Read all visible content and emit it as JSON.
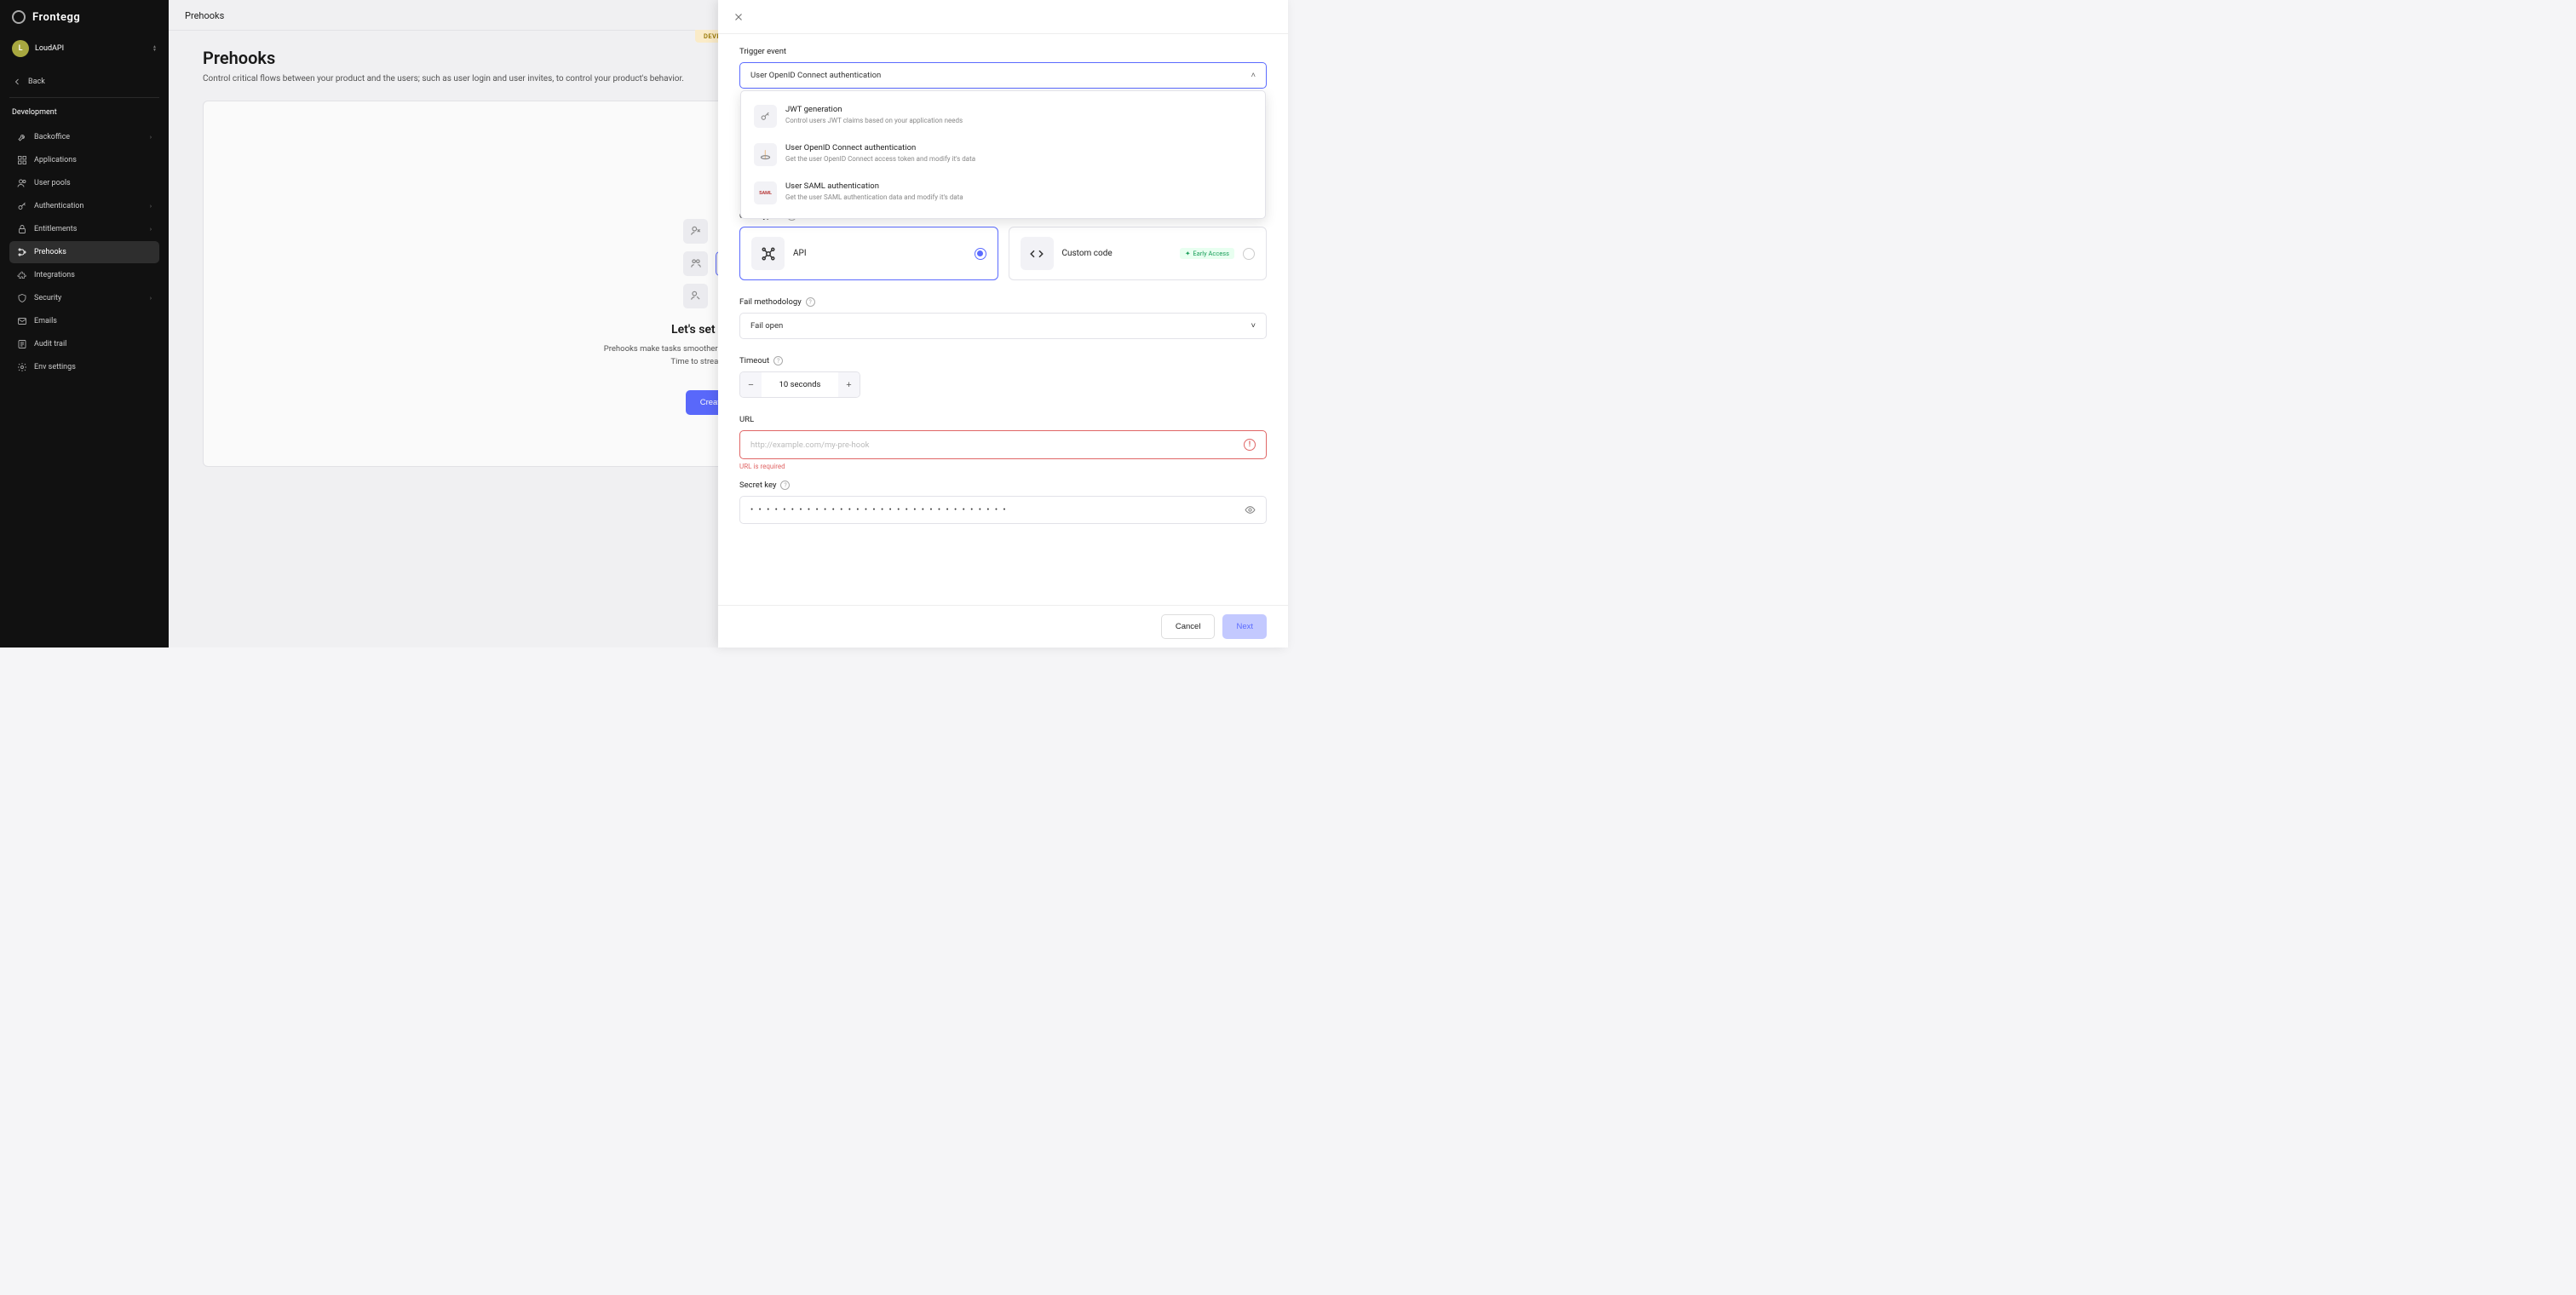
{
  "brand": {
    "name": "Frontegg"
  },
  "workspace": {
    "avatar_initial": "L",
    "name": "LoudAPI"
  },
  "back_label": "Back",
  "env_label": "Development",
  "env_pill": "DEVELOPMENT",
  "nav": [
    {
      "key": "backoffice",
      "label": "Backoffice",
      "chevron": true
    },
    {
      "key": "applications",
      "label": "Applications"
    },
    {
      "key": "user-pools",
      "label": "User pools"
    },
    {
      "key": "authentication",
      "label": "Authentication",
      "chevron": true
    },
    {
      "key": "entitlements",
      "label": "Entitlements",
      "chevron": true
    },
    {
      "key": "prehooks",
      "label": "Prehooks",
      "active": true
    },
    {
      "key": "integrations",
      "label": "Integrations"
    },
    {
      "key": "security",
      "label": "Security",
      "chevron": true
    },
    {
      "key": "emails",
      "label": "Emails"
    },
    {
      "key": "audit-trail",
      "label": "Audit trail"
    },
    {
      "key": "env-settings",
      "label": "Env settings"
    }
  ],
  "breadcrumb": "Prehooks",
  "page": {
    "title": "Prehooks",
    "description": "Control critical flows between your product and the users; such as user login and user invites, to control your product's behavior.",
    "empty_heading": "Let's set up Prehooks",
    "empty_line1": "Prehooks make tasks smoother by automating actions before events.",
    "empty_line2": "Time to streamlining workflows!",
    "create_button": "Create Prehook"
  },
  "panel": {
    "trigger_label": "Trigger event",
    "trigger_value": "User OpenID Connect authentication",
    "dropdown_items": [
      {
        "icon_kind": "key",
        "title": "JWT generation",
        "desc": "Control users JWT claims based on your application needs"
      },
      {
        "icon_kind": "oidc",
        "title": "User OpenID Connect authentication",
        "desc": "Get the user OpenID Connect access token and modify it's data"
      },
      {
        "icon_kind": "saml",
        "title": "User SAML authentication",
        "desc": "Get the user SAML authentication data and modify it's data"
      }
    ],
    "code_type_label": "Code type",
    "code_type_options": [
      {
        "key": "api",
        "label": "API",
        "selected": true
      },
      {
        "key": "custom",
        "label": "Custom code",
        "badge": "Early Access"
      }
    ],
    "fail_label": "Fail methodology",
    "fail_value": "Fail open",
    "timeout_label": "Timeout",
    "timeout_value": "10 seconds",
    "url_label": "URL",
    "url_placeholder": "http://example.com/my-pre-hook",
    "url_error": "URL is required",
    "secret_label": "Secret key",
    "secret_masked": "• • • • • • • • • • • • • • • • • • • • • • • • • • • • • • • •",
    "cancel": "Cancel",
    "next": "Next"
  }
}
